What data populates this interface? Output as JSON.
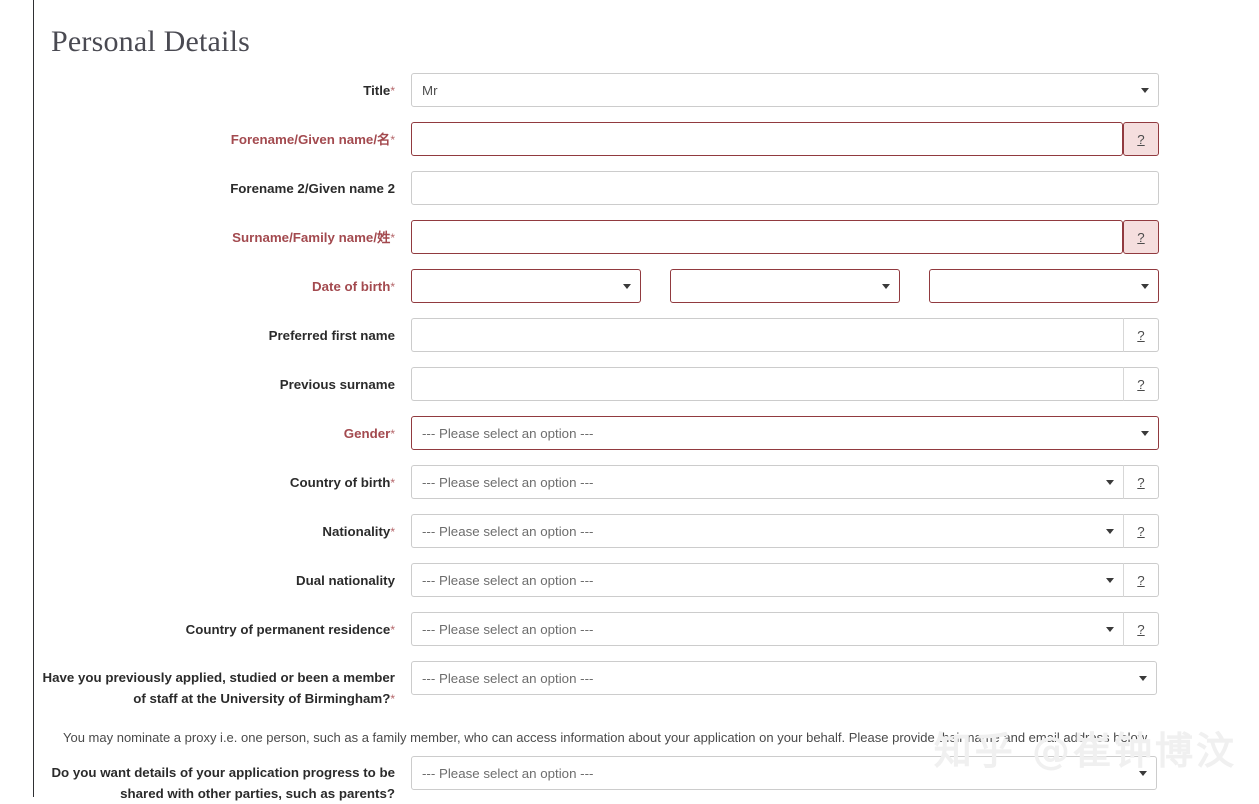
{
  "page": {
    "title": "Personal Details",
    "required_marker": "*",
    "help_glyph": "?",
    "colors": {
      "required_text": "#a34a4f",
      "required_border": "#913a3f",
      "required_help_bg": "#f5dede",
      "label_text": "#2b2b2b",
      "border": "#cccccc",
      "title_text": "#4a4a52",
      "left_rule": "#2f3033"
    },
    "select_placeholder": "--- Please select an option ---"
  },
  "fields": [
    {
      "key": "title",
      "label": "Title",
      "required": true,
      "label_error": false,
      "control": "select",
      "value": "Mr",
      "has_help": false,
      "error": false,
      "width": "full"
    },
    {
      "key": "forename",
      "label": "Forename/Given name/名",
      "required": true,
      "label_error": true,
      "control": "text",
      "value": "",
      "has_help": true,
      "error": true,
      "width": "with-help"
    },
    {
      "key": "forename2",
      "label": "Forename 2/Given name 2",
      "required": false,
      "label_error": false,
      "control": "text",
      "value": "",
      "has_help": false,
      "error": false,
      "width": "full"
    },
    {
      "key": "surname",
      "label": "Surname/Family name/姓",
      "required": true,
      "label_error": true,
      "control": "text",
      "value": "",
      "has_help": true,
      "error": true,
      "width": "with-help"
    },
    {
      "key": "dob",
      "label": "Date of birth",
      "required": true,
      "label_error": true,
      "control": "date-triple",
      "value": "",
      "has_help": false,
      "error": true,
      "parts": [
        "",
        "",
        ""
      ]
    },
    {
      "key": "preferred_first_name",
      "label": "Preferred first name",
      "required": false,
      "label_error": false,
      "control": "text",
      "value": "",
      "has_help": true,
      "error": false,
      "width": "with-help"
    },
    {
      "key": "previous_surname",
      "label": "Previous surname",
      "required": false,
      "label_error": false,
      "control": "text",
      "value": "",
      "has_help": true,
      "error": false,
      "width": "with-help"
    },
    {
      "key": "gender",
      "label": "Gender",
      "required": true,
      "label_error": true,
      "control": "select",
      "value": "--- Please select an option ---",
      "has_help": false,
      "error": true,
      "width": "full"
    },
    {
      "key": "country_of_birth",
      "label": "Country of birth",
      "required": true,
      "label_error": false,
      "control": "select",
      "value": "--- Please select an option ---",
      "has_help": true,
      "error": false,
      "width": "with-help"
    },
    {
      "key": "nationality",
      "label": "Nationality",
      "required": true,
      "label_error": false,
      "control": "select",
      "value": "--- Please select an option ---",
      "has_help": true,
      "error": false,
      "width": "with-help"
    },
    {
      "key": "dual_nationality",
      "label": "Dual nationality",
      "required": false,
      "label_error": false,
      "control": "select",
      "value": "--- Please select an option ---",
      "has_help": true,
      "error": false,
      "width": "with-help"
    },
    {
      "key": "country_of_permanent_residence",
      "label": "Country of permanent residence",
      "required": true,
      "label_error": false,
      "control": "select",
      "value": "--- Please select an option ---",
      "has_help": true,
      "error": false,
      "width": "with-help"
    },
    {
      "key": "previously_applied",
      "label": "Have you previously applied, studied or been a member of staff at the University of Birmingham?",
      "required": true,
      "label_error": false,
      "control": "select",
      "value": "--- Please select an option ---",
      "has_help": false,
      "error": false,
      "width": "q-wide"
    }
  ],
  "proxy_note": "You may nominate a proxy i.e. one person, such as a family member, who can access information about your application on your behalf. Please provide their name and email address below.",
  "share_field": {
    "key": "share_progress",
    "label": "Do you want details of your application progress to be shared with other parties, such as parents?",
    "required": false,
    "label_error": false,
    "control": "select",
    "value": "--- Please select an option ---",
    "has_help": false,
    "error": false,
    "width": "q-wide"
  },
  "watermark": "知乎 @崔钟博汶"
}
